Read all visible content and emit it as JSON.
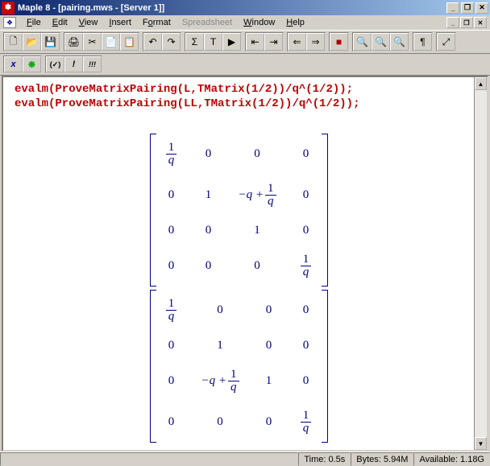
{
  "title": "Maple 8  - [pairing.mws  - [Server 1]]",
  "menu": {
    "file": "File",
    "edit": "Edit",
    "view": "View",
    "insert": "Insert",
    "format": "Format",
    "spreadsheet": "Spreadsheet",
    "window": "Window",
    "help": "Help"
  },
  "toolbar_icons": {
    "new": "🗋",
    "open": "📂",
    "save": "💾",
    "print": "🖨",
    "cut": "✂",
    "copy": "📄",
    "paste": "📋",
    "undo": "↶",
    "redo": "↷",
    "sigma": "Σ",
    "text": "T",
    "group": "▶",
    "outdent": "⇤",
    "indent": "⇥",
    "back": "⇐",
    "forward": "⇒",
    "stop": "■",
    "zoomin": "🔍",
    "zoomout": "🔍",
    "zoomreset": "🔍",
    "pilcrow": "¶",
    "resize": "⤢"
  },
  "context_icons": {
    "x": "x",
    "leaf": "❋",
    "exec": "(✓)",
    "excl": "!",
    "bang3": "!!!"
  },
  "code": {
    "l1": "evalm(ProveMatrixPairing(L,TMatrix(1/2))/q^(1/2));",
    "l2": "evalm(ProveMatrixPairing(LL,TMatrix(1/2))/q^(1/2));"
  },
  "status": {
    "time": "Time:    0.5s",
    "bytes": "Bytes: 5.94M",
    "avail": "Available: 1.18G"
  },
  "sym": {
    "zero": "0",
    "one": "1",
    "q": "q",
    "minus_q_plus": "−q +"
  },
  "chart_data": [
    {
      "type": "table",
      "title": "Matrix result 1 (evalm ProveMatrixPairing(L,TMatrix(1/2))/q^(1/2))",
      "rows": [
        [
          "1/q",
          "0",
          "0",
          "0"
        ],
        [
          "0",
          "1",
          "-q + 1/q",
          "0"
        ],
        [
          "0",
          "0",
          "1",
          "0"
        ],
        [
          "0",
          "0",
          "0",
          "1/q"
        ]
      ]
    },
    {
      "type": "table",
      "title": "Matrix result 2 (evalm ProveMatrixPairing(LL,TMatrix(1/2))/q^(1/2))",
      "rows": [
        [
          "1/q",
          "0",
          "0",
          "0"
        ],
        [
          "0",
          "1",
          "0",
          "0"
        ],
        [
          "0",
          "-q + 1/q",
          "1",
          "0"
        ],
        [
          "0",
          "0",
          "0",
          "1/q"
        ]
      ]
    }
  ]
}
